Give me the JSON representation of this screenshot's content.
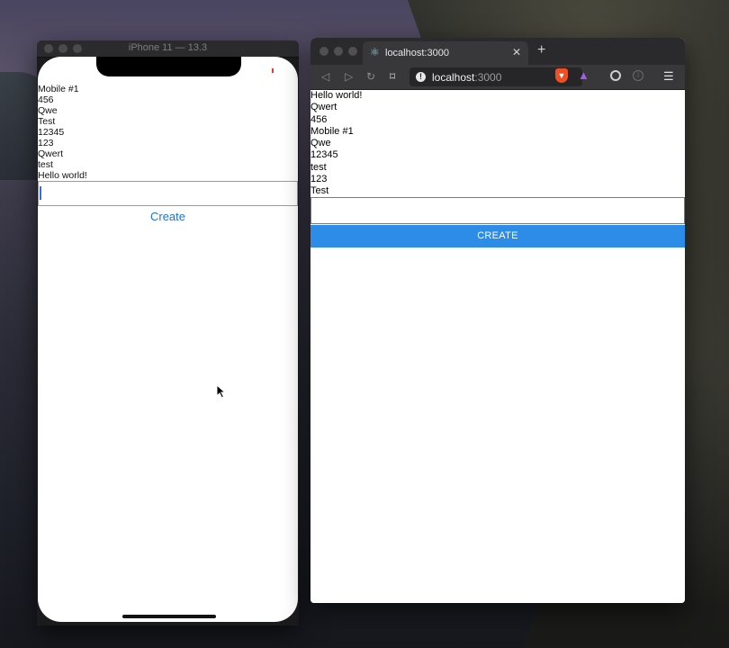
{
  "simulator": {
    "title": "iPhone 11 — 13.3",
    "items": [
      "Mobile #1",
      "456",
      "Qwe",
      "Test",
      "12345",
      "123",
      "Qwert",
      "test",
      "Hello world!"
    ],
    "input_value": "",
    "create_label": "Create"
  },
  "browser": {
    "tab_title": "localhost:3000",
    "url_host": "localhost",
    "url_port": ":3000",
    "items": [
      "Hello world!",
      "Qwert",
      "456",
      "Mobile #1",
      "Qwe",
      "12345",
      "test",
      "123",
      "Test"
    ],
    "input_value": "",
    "create_label": "CREATE"
  },
  "icons": {
    "back": "back-arrow-icon",
    "forward": "forward-arrow-icon",
    "reload": "reload-icon",
    "bookmark": "bookmark-icon",
    "info": "info-icon",
    "brave": "brave-shield-icon",
    "rewards": "brave-rewards-icon",
    "menu": "hamburger-menu-icon"
  },
  "colors": {
    "accent_button": "#2d8ce8",
    "ios_link": "#1a73d9"
  }
}
